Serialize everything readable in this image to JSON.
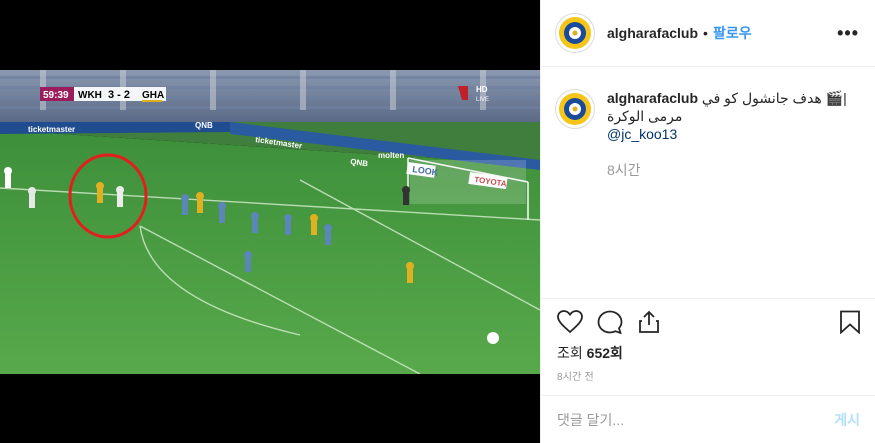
{
  "video": {
    "score": {
      "clock": "59:39",
      "home": "WKH",
      "score": "3 - 2",
      "away": "GHA",
      "broadcaster": "HD",
      "live": "LIVE"
    },
    "ads": [
      "ticketmaster",
      "ticketmaster",
      "QNB",
      "QNB",
      "LOOK",
      "TOYOTA",
      "molten"
    ],
    "play_state": "playing"
  },
  "post": {
    "username": "algharafaclub",
    "follow_label": "팔로우",
    "more_label": "•••",
    "caption_username": "algharafaclub",
    "caption_line1": "هدف جانشول كو في 🎬|",
    "caption_line2": "مرمى الوكرة",
    "mention": "@jc_koo13",
    "caption_time": "8시간",
    "views_label": "조회",
    "views_count": "652회",
    "age": "8시간 전",
    "comment_placeholder": "댓글 달기...",
    "post_label": "게시",
    "icons": [
      "heart-icon",
      "comment-icon",
      "share-icon",
      "bookmark-icon"
    ],
    "colors": {
      "link": "#3897f0",
      "mention": "#003569",
      "post_disabled": "#b2dffc",
      "border": "#efefef"
    }
  }
}
